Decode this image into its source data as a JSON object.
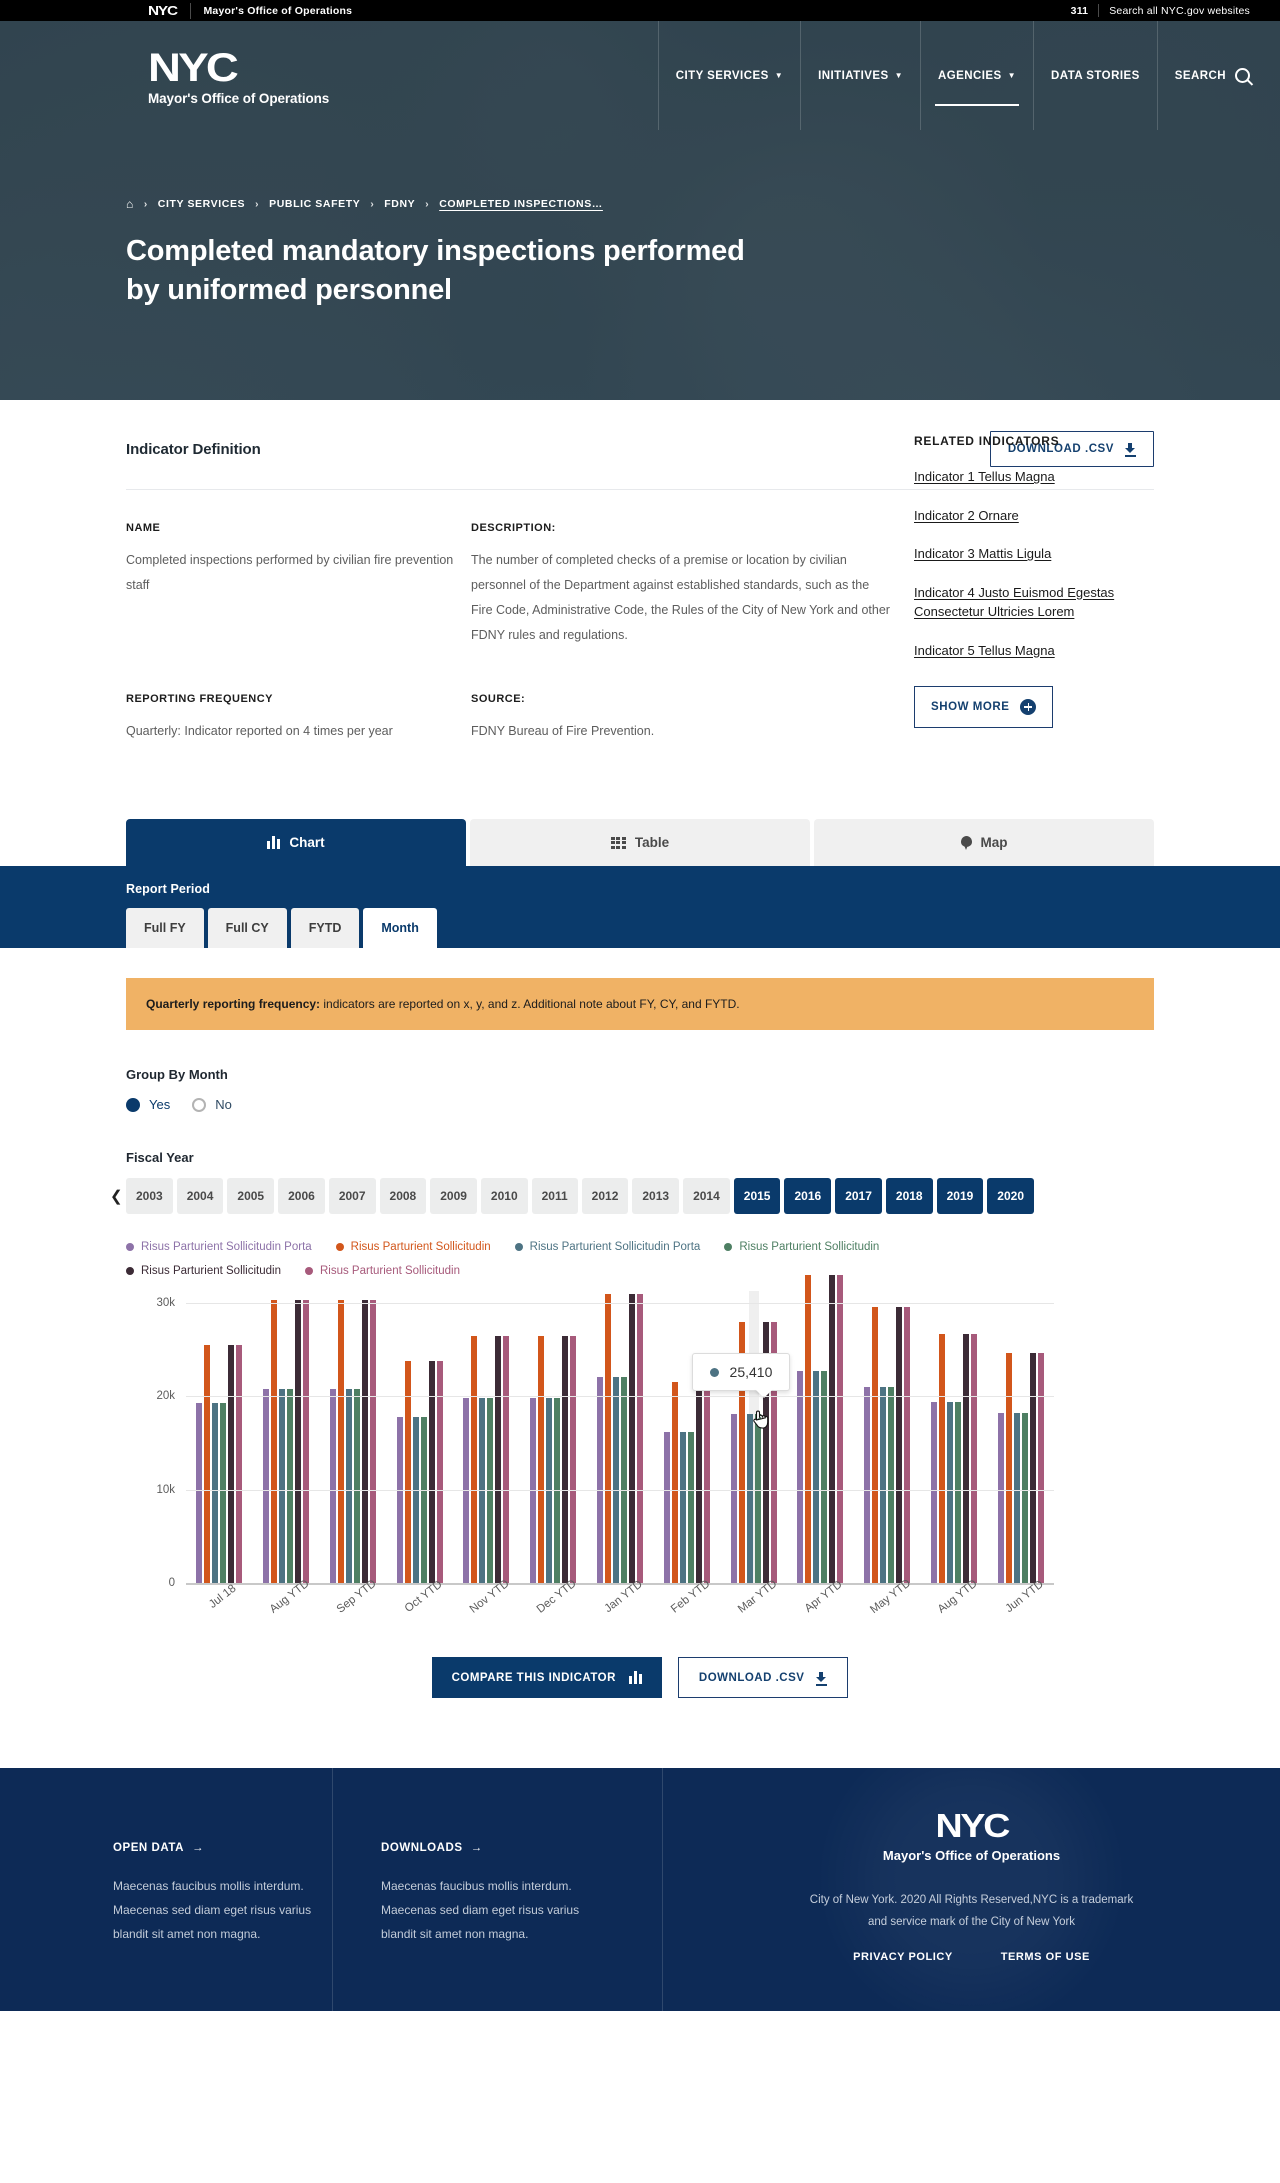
{
  "utility": {
    "nyc_mark": "NYC",
    "office": "Mayor's Office of Operations",
    "phone": "311",
    "search_all": "Search all NYC.gov websites"
  },
  "masthead": {
    "logo": "NYC",
    "logo_sub": "Mayor's Office of Operations",
    "nav": [
      {
        "label": "CITY SERVICES",
        "caret": "▼",
        "active": false
      },
      {
        "label": "INITIATIVES",
        "caret": "▼",
        "active": false
      },
      {
        "label": "AGENCIES",
        "caret": "▼",
        "active": true
      },
      {
        "label": "DATA STORIES",
        "caret": "",
        "active": false
      },
      {
        "label": "SEARCH",
        "caret": "",
        "active": false
      }
    ]
  },
  "breadcrumb": {
    "home_icon": "home-icon",
    "separator": "›",
    "items": [
      "CITY SERVICES",
      "PUBLIC SAFETY",
      "FDNY",
      "COMPLETED INSPECTIONS…"
    ]
  },
  "hero": {
    "title": "Completed mandatory inspections performed by uniformed personnel"
  },
  "definition": {
    "heading": "Indicator Definition",
    "download_label": "DOWNLOAD .CSV",
    "name_label": "NAME",
    "name_value": "Completed inspections performed by civilian fire prevention staff",
    "description_label": "DESCRIPTION:",
    "description_value": "The number of completed checks of a premise or location by civilian personnel of the Department against established standards, such as the Fire Code, Administrative Code, the Rules of the City of New York and other FDNY rules and regulations.",
    "frequency_label": "REPORTING FREQUENCY",
    "frequency_value": "Quarterly: Indicator reported on 4 times per year",
    "source_label": "SOURCE:",
    "source_value": "FDNY Bureau of Fire Prevention."
  },
  "related": {
    "heading": "RELATED INDICATORS",
    "links": [
      "Indicator 1 Tellus Magna",
      "Indicator 2 Ornare",
      "Indicator 3 Mattis Ligula",
      "Indicator 4 Justo Euismod Egestas Consectetur Ultricies Lorem",
      "Indicator 5 Tellus Magna"
    ],
    "show_more": "SHOW MORE"
  },
  "tabs": [
    {
      "label": "Chart",
      "icon": "bar-chart-icon",
      "active": true
    },
    {
      "label": "Table",
      "icon": "table-icon",
      "active": false
    },
    {
      "label": "Map",
      "icon": "map-pin-icon",
      "active": false
    }
  ],
  "report_period": {
    "label": "Report Period",
    "options": [
      {
        "label": "Full FY",
        "active": false
      },
      {
        "label": "Full CY",
        "active": false
      },
      {
        "label": "FYTD",
        "active": false
      },
      {
        "label": "Month",
        "active": true
      }
    ]
  },
  "alert": {
    "strong": "Quarterly reporting frequency:",
    "text": " indicators are reported on x, y, and z. Additional note about FY, CY, and FYTD."
  },
  "group_by": {
    "label": "Group By Month",
    "options": [
      {
        "label": "Yes",
        "selected": true
      },
      {
        "label": "No",
        "selected": false
      }
    ]
  },
  "fiscal_year": {
    "label": "Fiscal Year",
    "prev_icon": "chevron-left-icon",
    "years": [
      {
        "year": "2003",
        "active": false
      },
      {
        "year": "2004",
        "active": false
      },
      {
        "year": "2005",
        "active": false
      },
      {
        "year": "2006",
        "active": false
      },
      {
        "year": "2007",
        "active": false
      },
      {
        "year": "2008",
        "active": false
      },
      {
        "year": "2009",
        "active": false
      },
      {
        "year": "2010",
        "active": false
      },
      {
        "year": "2011",
        "active": false
      },
      {
        "year": "2012",
        "active": false
      },
      {
        "year": "2013",
        "active": false
      },
      {
        "year": "2014",
        "active": false
      },
      {
        "year": "2015",
        "active": true
      },
      {
        "year": "2016",
        "active": true
      },
      {
        "year": "2017",
        "active": true
      },
      {
        "year": "2018",
        "active": true
      },
      {
        "year": "2019",
        "active": true
      },
      {
        "year": "2020",
        "active": true
      }
    ]
  },
  "chart_footer": {
    "compare_label": "COMPARE THIS INDICATOR",
    "download_label": "DOWNLOAD .CSV"
  },
  "tooltip": {
    "value": "25,410",
    "dot_color": "#4d7383"
  },
  "chart_data": {
    "type": "bar",
    "title": "",
    "xlabel": "",
    "ylabel": "",
    "ylim": [
      0,
      30000
    ],
    "yticks": [
      "0",
      "10k",
      "20k",
      "30k"
    ],
    "ytick_values": [
      0,
      10000,
      20000,
      30000
    ],
    "grid": true,
    "legend_position": "top",
    "categories": [
      "Jul 18",
      "Aug YTD",
      "Sep YTD",
      "Oct YTD",
      "Nov YTD",
      "Dec YTD",
      "Jan YTD",
      "Feb YTD",
      "Mar YTD",
      "Apr YTD",
      "May YTD",
      "Aug YTD",
      "Jun YTD"
    ],
    "series": [
      {
        "name": "Risus Parturient Sollicitudin Porta",
        "color": "#8d72a8",
        "values": [
          19300,
          20800,
          20800,
          17800,
          19800,
          19800,
          22100,
          16200,
          18100,
          22700,
          21000,
          19400,
          18200
        ]
      },
      {
        "name": "Risus Parturient Sollicitudin",
        "color": "#d2561b",
        "values": [
          25500,
          30300,
          30300,
          23800,
          26500,
          26500,
          31000,
          21500,
          28000,
          33000,
          29600,
          26700,
          24600
        ]
      },
      {
        "name": "Risus Parturient Sollicitudin Porta",
        "color": "#4d7383",
        "values": [
          19300,
          20800,
          20800,
          17800,
          19800,
          19800,
          22100,
          16200,
          18100,
          22700,
          21000,
          19400,
          18200
        ]
      },
      {
        "name": "Risus Parturient Sollicitudin",
        "color": "#4e7f63",
        "values": [
          19300,
          20800,
          20800,
          17800,
          19800,
          19800,
          22100,
          16200,
          18100,
          22700,
          21000,
          19400,
          18200
        ]
      },
      {
        "name": "Risus Parturient Sollicitudin",
        "color": "#3c2b36",
        "values": [
          25500,
          30300,
          30300,
          23800,
          26500,
          26500,
          31000,
          24300,
          28000,
          33000,
          29600,
          26700,
          24600
        ]
      },
      {
        "name": "Risus Parturient Sollicitudin",
        "color": "#a75a7b",
        "values": [
          25500,
          30300,
          30300,
          23800,
          26500,
          26500,
          31000,
          24300,
          28000,
          33000,
          29600,
          26700,
          24600
        ]
      }
    ],
    "hovered_category": "Mar YTD",
    "hovered_value": 25410
  },
  "footer": {
    "col1": {
      "link": "OPEN DATA",
      "arrow": "→",
      "body": "Maecenas faucibus mollis interdum. Maecenas sed diam eget risus varius blandit sit amet non magna."
    },
    "col2": {
      "link": "DOWNLOADS",
      "arrow": "→",
      "body": "Maecenas faucibus mollis interdum. Maecenas sed diam eget risus varius blandit sit amet non magna."
    },
    "col3": {
      "logo": "NYC",
      "logo_sub": "Mayor's Office of Operations",
      "copyright": "City of New York. 2020 All Rights Reserved,NYC is a trademark and service mark of the City of New York",
      "privacy": "PRIVACY POLICY",
      "terms": "TERMS OF USE"
    }
  }
}
